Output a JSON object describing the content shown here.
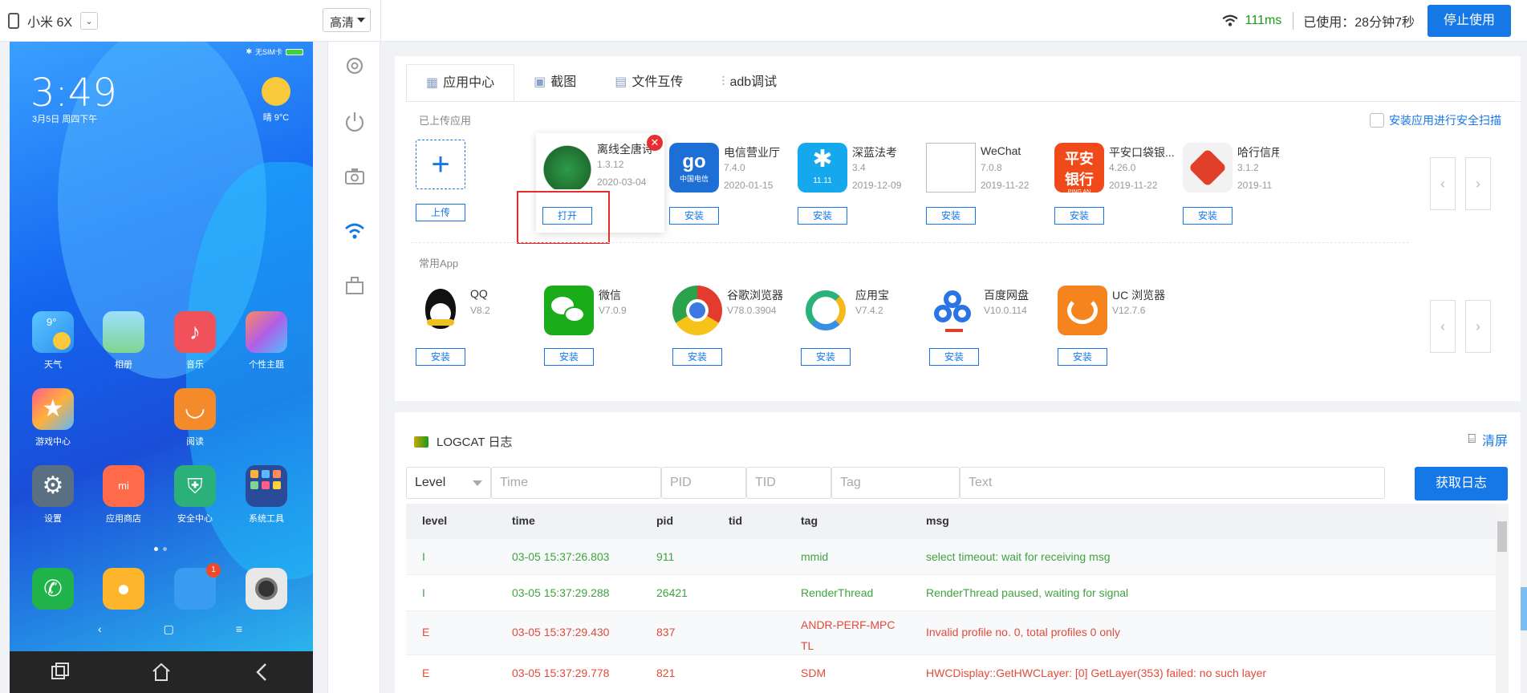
{
  "topbar": {
    "device_name": "小米 6X",
    "quality": "高清",
    "latency": "111ms",
    "used_time": "已使用：28分钟7秒",
    "stop_label": "停止使用"
  },
  "phone": {
    "status_text": "无SIM卡",
    "time": "3:49",
    "date": "3月5日 周四下午",
    "weather_temp": "晴 9°C",
    "weather_icon_value": "9°",
    "apps": [
      {
        "label": "天气"
      },
      {
        "label": "相册"
      },
      {
        "label": "音乐"
      },
      {
        "label": "个性主题"
      },
      {
        "label": "游戏中心"
      },
      {
        "label": "阅读"
      },
      {
        "label": "设置"
      },
      {
        "label": "应用商店"
      },
      {
        "label": "安全中心"
      },
      {
        "label": "系统工具"
      }
    ],
    "dock_badge": "1",
    "store_logo": "mi"
  },
  "tabs": [
    {
      "label": "应用中心"
    },
    {
      "label": "截图"
    },
    {
      "label": "文件互传"
    },
    {
      "label": "adb调试"
    }
  ],
  "uploaded": {
    "section_label": "已上传应用",
    "scan_label": "安装应用进行安全扫描",
    "upload_label": "上传",
    "open_label": "打开",
    "install_label": "安装",
    "apps": [
      {
        "name": "离线全唐诗",
        "version": "1.3.12",
        "date": "2020-03-04"
      },
      {
        "name": "电信营业厅",
        "version": "7.4.0",
        "date": "2020-01-15"
      },
      {
        "name": "深蓝法考",
        "version": "3.4",
        "date": "2019-12-09"
      },
      {
        "name": "WeChat",
        "version": "7.0.8",
        "date": "2019-11-22"
      },
      {
        "name": "平安口袋银...",
        "version": "4.26.0",
        "date": "2019-11-22"
      },
      {
        "name": "哈行信用",
        "version": "3.1.2",
        "date": "2019-11"
      }
    ],
    "icon_text": {
      "telecom": "go",
      "telecom_sub": "中国电信",
      "shenlan": "11.11",
      "pingan_top": "平安",
      "pingan_bottom": "银行",
      "pingan_small": "PING AN"
    }
  },
  "common": {
    "section_label": "常用App",
    "install_label": "安装",
    "apps": [
      {
        "name": "QQ",
        "version": "V8.2"
      },
      {
        "name": "微信",
        "version": "V7.0.9"
      },
      {
        "name": "谷歌浏览器",
        "version": "V78.0.3904"
      },
      {
        "name": "应用宝",
        "version": "V7.4.2"
      },
      {
        "name": "百度网盘",
        "version": "V10.0.114"
      },
      {
        "name": "UC 浏览器",
        "version": "V12.7.6"
      }
    ]
  },
  "pager": {
    "prev": "‹",
    "next": "›"
  },
  "logcat": {
    "title": "LOGCAT 日志",
    "clear_label": "清屏",
    "get_label": "获取日志",
    "filters": {
      "level": "Level",
      "time": "Time",
      "pid": "PID",
      "tid": "TID",
      "tag": "Tag",
      "text": "Text"
    },
    "columns": [
      "level",
      "time",
      "pid",
      "tid",
      "tag",
      "msg"
    ],
    "rows": [
      {
        "level": "I",
        "time": "03-05 15:37:26.803",
        "pid": "911",
        "tid": "",
        "tag": "mmid",
        "msg": "select timeout: wait for receiving msg",
        "color": "#3fa33f"
      },
      {
        "level": "I",
        "time": "03-05 15:37:29.288",
        "pid": "26421",
        "tid": "",
        "tag": "RenderThread",
        "msg": "RenderThread paused, waiting for signal",
        "color": "#3fa33f"
      },
      {
        "level": "E",
        "time": "03-05 15:37:29.430",
        "pid": "837",
        "tid": "",
        "tag": "ANDR-PERF-MPCTL",
        "tag_line1": "ANDR-PERF-MPC",
        "tag_line2": "TL",
        "msg": "Invalid profile no. 0, total profiles 0 only",
        "color": "#e04b3b"
      },
      {
        "level": "E",
        "time": "03-05 15:37:29.778",
        "pid": "821",
        "tid": "",
        "tag": "SDM",
        "msg": "HWCDisplay::GetHWCLayer: [0] GetLayer(353) failed: no such layer",
        "color": "#e04b3b"
      }
    ]
  },
  "colors": {
    "accent": "#1677e6",
    "info": "#3fa33f",
    "error": "#e04b3b"
  }
}
